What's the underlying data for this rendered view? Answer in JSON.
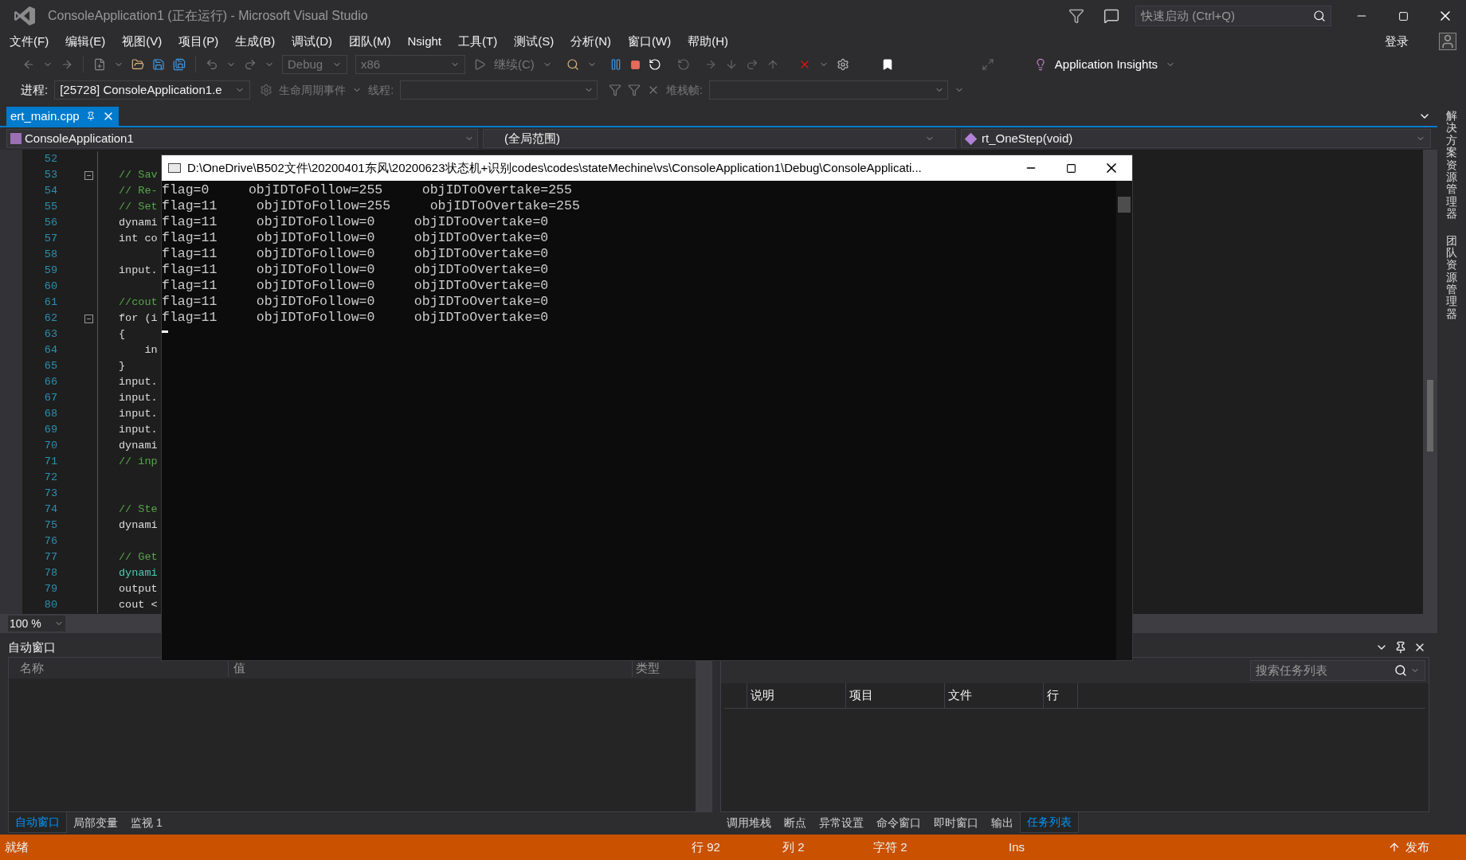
{
  "window": {
    "title": "ConsoleApplication1 (正在运行) - Microsoft Visual Studio",
    "quick_launch": {
      "placeholder": "快速启动 (Ctrl+Q)"
    },
    "sign_in": "登录"
  },
  "menu": [
    "文件(F)",
    "编辑(E)",
    "视图(V)",
    "项目(P)",
    "生成(B)",
    "调试(D)",
    "团队(M)",
    "Nsight",
    "工具(T)",
    "测试(S)",
    "分析(N)",
    "窗口(W)",
    "帮助(H)"
  ],
  "toolbar": {
    "configuration": "Debug",
    "platform": "x86",
    "continue": "继续(C)",
    "insights": "Application Insights"
  },
  "debug_location": {
    "process_label": "进程:",
    "process": "[25728] ConsoleApplication1.e",
    "lifecycle": "生命周期事件",
    "thread_label": "线程:",
    "stack_label": "堆栈帧:"
  },
  "document_tabs": [
    {
      "label": "ert_main.cpp",
      "selected": true
    }
  ],
  "nav_bar": {
    "project": "ConsoleApplication1",
    "scope": "(全局范围)",
    "member": "rt_OneStep(void)"
  },
  "editor": {
    "zoom": "100 %",
    "lines": [
      {
        "number": "52",
        "kind": "blank",
        "fold": false
      },
      {
        "number": "53",
        "kind": "comment",
        "text": "// Sav",
        "fold": true
      },
      {
        "number": "54",
        "kind": "comment",
        "text": "// Re-",
        "fold": false
      },
      {
        "number": "55",
        "kind": "comment",
        "text": "// Set",
        "fold": false
      },
      {
        "number": "56",
        "kind": "code",
        "text": "dynami",
        "fold": false
      },
      {
        "number": "57",
        "kind": "code",
        "text": "int co",
        "fold": false
      },
      {
        "number": "58",
        "kind": "blank",
        "fold": false
      },
      {
        "number": "59",
        "kind": "code",
        "text": "input.",
        "fold": false
      },
      {
        "number": "60",
        "kind": "blank",
        "fold": false
      },
      {
        "number": "61",
        "kind": "comment",
        "text": "//cout",
        "fold": false
      },
      {
        "number": "62",
        "kind": "code",
        "text": "for (i",
        "fold": true
      },
      {
        "number": "63",
        "kind": "code",
        "text": "{",
        "fold": false
      },
      {
        "number": "64",
        "kind": "code",
        "text": "    in",
        "fold": false
      },
      {
        "number": "65",
        "kind": "code",
        "text": "}",
        "fold": false
      },
      {
        "number": "66",
        "kind": "code",
        "text": "input.",
        "fold": false
      },
      {
        "number": "67",
        "kind": "code",
        "text": "input.",
        "fold": false
      },
      {
        "number": "68",
        "kind": "code",
        "text": "input.",
        "fold": false
      },
      {
        "number": "69",
        "kind": "code",
        "text": "input.",
        "fold": false
      },
      {
        "number": "70",
        "kind": "code",
        "text": "dynami",
        "fold": false
      },
      {
        "number": "71",
        "kind": "comment",
        "text": "// inp",
        "fold": false
      },
      {
        "number": "72",
        "kind": "blank",
        "fold": false
      },
      {
        "number": "73",
        "kind": "blank",
        "fold": false
      },
      {
        "number": "74",
        "kind": "comment",
        "text": "// Ste",
        "fold": false
      },
      {
        "number": "75",
        "kind": "code",
        "text": "dynami",
        "fold": false
      },
      {
        "number": "76",
        "kind": "blank",
        "fold": false
      },
      {
        "number": "77",
        "kind": "comment",
        "text": "// Get",
        "fold": false
      },
      {
        "number": "78",
        "kind": "function",
        "text": "dynami",
        "fold": false
      },
      {
        "number": "79",
        "kind": "code",
        "text": "output",
        "fold": false
      },
      {
        "number": "80",
        "kind": "code",
        "text": "cout <",
        "fold": false
      }
    ]
  },
  "console": {
    "title": "D:\\OneDrive\\B502文件\\20200401东风\\20200623状态机+识别codes\\codes\\stateMechine\\vs\\ConsoleApplication1\\Debug\\ConsoleApplicati...",
    "lines": [
      "flag=0     objIDToFollow=255     objIDToOvertake=255",
      "flag=11     objIDToFollow=255     objIDToOvertake=255",
      "flag=11     objIDToFollow=0     objIDToOvertake=0",
      "flag=11     objIDToFollow=0     objIDToOvertake=0",
      "flag=11     objIDToFollow=0     objIDToOvertake=0",
      "flag=11     objIDToFollow=0     objIDToOvertake=0",
      "flag=11     objIDToFollow=0     objIDToOvertake=0",
      "flag=11     objIDToFollow=0     objIDToOvertake=0",
      "flag=11     objIDToFollow=0     objIDToOvertake=0"
    ]
  },
  "side_tabs": [
    "解决方案资源管理器",
    "团队资源管理器"
  ],
  "autos_panel": {
    "title": "自动窗口",
    "columns": [
      "名称",
      "值",
      "类型"
    ],
    "tabs": [
      {
        "label": "自动窗口",
        "selected": true
      },
      {
        "label": "局部变量",
        "selected": false
      },
      {
        "label": "监视 1",
        "selected": false
      }
    ]
  },
  "task_list": {
    "search": {
      "placeholder": "搜索任务列表"
    },
    "columns": [
      "说明",
      "项目",
      "文件",
      "行"
    ],
    "tabs": [
      {
        "label": "调用堆栈",
        "selected": false
      },
      {
        "label": "断点",
        "selected": false
      },
      {
        "label": "异常设置",
        "selected": false
      },
      {
        "label": "命令窗口",
        "selected": false
      },
      {
        "label": "即时窗口",
        "selected": false
      },
      {
        "label": "输出",
        "selected": false
      },
      {
        "label": "任务列表",
        "selected": true
      }
    ]
  },
  "status_bar": {
    "state": "就绪",
    "line": "行 92",
    "column": "列 2",
    "char": "字符 2",
    "mode": "Ins",
    "publish": "发布"
  }
}
